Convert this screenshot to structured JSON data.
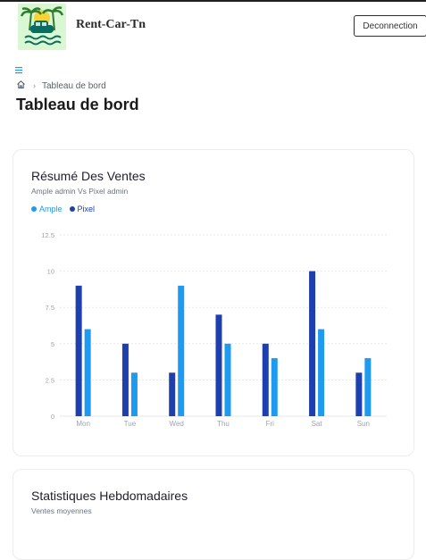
{
  "header": {
    "app_title": "Rent-Car-Tn",
    "logout_label": "Deconnection"
  },
  "breadcrumb": {
    "current": "Tableau de bord"
  },
  "page": {
    "title": "Tableau de bord"
  },
  "sales_card": {
    "title": "Résumé Des Ventes",
    "subtitle": "Ample admin Vs Pixel admin"
  },
  "weekly_card": {
    "title": "Statistiques Hebdomadaires",
    "subtitle": "Ventes moyennes"
  },
  "colors": {
    "ample": "#1e9bf0",
    "pixel": "#1e40af",
    "grid": "#e5e7eb",
    "tick": "#9ca3af"
  },
  "chart_data": {
    "type": "bar",
    "categories": [
      "Mon",
      "Tue",
      "Wed",
      "Thu",
      "Fri",
      "Sat",
      "Sun"
    ],
    "series": [
      {
        "name": "Pixel",
        "values": [
          9,
          5,
          3,
          7,
          5,
          10,
          3
        ]
      },
      {
        "name": "Ample",
        "values": [
          6,
          3,
          9,
          5,
          4,
          6,
          4
        ]
      }
    ],
    "ylim": [
      0,
      12.5
    ],
    "yticks": [
      "0",
      "2.5",
      "5",
      "7.5",
      "10",
      "12.5"
    ],
    "grid": true,
    "legend_position": "top-left"
  }
}
